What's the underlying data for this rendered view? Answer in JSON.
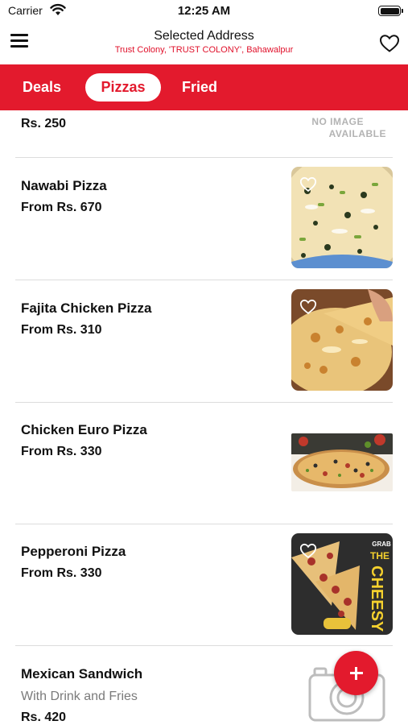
{
  "status_bar": {
    "carrier": "Carrier",
    "time": "12:25 AM"
  },
  "header": {
    "title": "Selected Address",
    "subtitle": "Trust Colony, 'TRUST COLONY', Bahawalpur",
    "accent_color": "#e31a2d"
  },
  "tabs": [
    {
      "label": "Deals",
      "selected": false
    },
    {
      "label": "Pizzas",
      "selected": true
    },
    {
      "label": "Fried",
      "selected": false
    }
  ],
  "items": [
    {
      "name": "",
      "price": "Rs. 250",
      "image": "no-image",
      "no_image_line1": "NO IMAGE",
      "no_image_line2": "AVAILABLE"
    },
    {
      "name": "Nawabi Pizza",
      "price": "From Rs. 670",
      "image": "nawabi-pizza-photo"
    },
    {
      "name": "Fajita Chicken Pizza",
      "price": "From Rs. 310",
      "image": "fajita-chicken-pizza-photo"
    },
    {
      "name": "Chicken Euro Pizza",
      "price": "From Rs. 330",
      "image": "chicken-euro-pizza-photo"
    },
    {
      "name": "Pepperoni Pizza",
      "price": "From Rs. 330",
      "image": "pepperoni-pizza-photo",
      "poster_text_1": "GRAB",
      "poster_text_2": "THE",
      "poster_text_3": "CHEESY"
    },
    {
      "name": "Mexican Sandwich",
      "description": "With Drink and Fries",
      "price": "Rs. 420",
      "image": "camera-placeholder"
    }
  ],
  "icons": {
    "menu": "hamburger-menu-icon",
    "favorite": "heart-outline-icon",
    "add": "plus-icon",
    "placeholder": "camera-icon"
  }
}
